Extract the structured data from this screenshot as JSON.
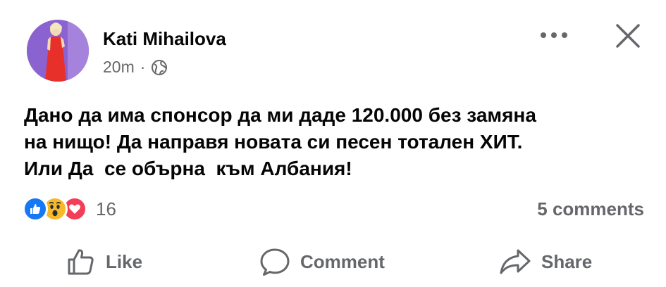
{
  "post": {
    "author": "Kati Mihailova",
    "time": "20m",
    "separator": "·",
    "audience_icon": "globe-icon",
    "more_icon": "more-dots-icon",
    "close_icon": "close-icon",
    "text_lines": [
      "Дано да има спонсор да ми даде 120.000 без замяна",
      "на нищо! Да направя новата си песен тотален ХИТ.",
      "Или Да  се обърна  към Албания!"
    ]
  },
  "reactions": {
    "icons": [
      "like-reaction-icon",
      "wow-reaction-icon",
      "love-reaction-icon"
    ],
    "count": "16"
  },
  "comments_count": "5 comments",
  "actions": {
    "like": "Like",
    "comment": "Comment",
    "share": "Share"
  },
  "colors": {
    "text": "#050505",
    "secondary": "#65676b",
    "like_blue": "#1877f2",
    "wow_yellow": "#f7b928",
    "love_red": "#f33e58"
  }
}
